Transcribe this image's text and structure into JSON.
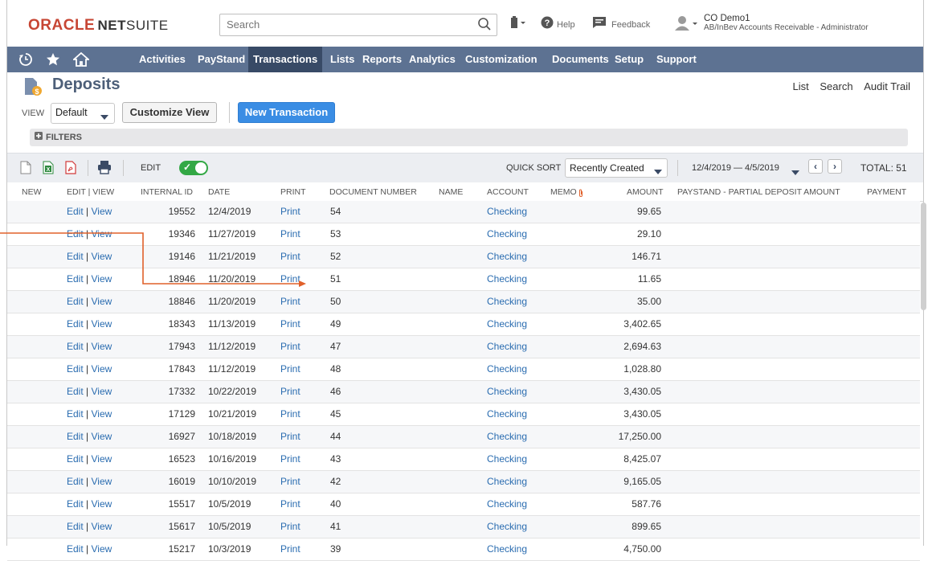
{
  "header": {
    "logo_oracle": "ORACLE",
    "logo_net": "NET",
    "logo_suite": "SUITE",
    "search_placeholder": "Search",
    "help_label": "Help",
    "feedback_label": "Feedback",
    "user_name": "CO Demo1",
    "user_role": "AB/InBev Accounts Receivable - Administrator"
  },
  "nav": {
    "items": [
      "Activities",
      "PayStand",
      "Transactions",
      "Lists",
      "Reports",
      "Analytics",
      "Customization",
      "Documents",
      "Setup",
      "Support"
    ],
    "active": "Transactions"
  },
  "page": {
    "title": "Deposits",
    "links": [
      "List",
      "Search",
      "Audit Trail"
    ],
    "view_label": "VIEW",
    "view_value": "Default",
    "customize_view": "Customize View",
    "new_transaction": "New Transaction",
    "filters_label": "FILTERS"
  },
  "toolbar": {
    "edit_label": "EDIT",
    "quick_sort_label": "QUICK SORT",
    "quick_sort_value": "Recently Created",
    "date_range": "12/4/2019 — 4/5/2019",
    "total": "TOTAL: 51"
  },
  "table": {
    "columns": [
      "NEW",
      "EDIT | VIEW",
      "INTERNAL ID",
      "DATE",
      "PRINT",
      "DOCUMENT NUMBER",
      "NAME",
      "ACCOUNT",
      "MEMO",
      "AMOUNT",
      "PAYSTAND - PARTIAL DEPOSIT AMOUNT",
      "PAYMENT"
    ],
    "edit_text": "Edit",
    "view_text": "View",
    "print_text": "Print",
    "rows": [
      {
        "id": "19552",
        "date": "12/4/2019",
        "doc": "54",
        "account": "Checking",
        "amount": "99.65"
      },
      {
        "id": "19346",
        "date": "11/27/2019",
        "doc": "53",
        "account": "Checking",
        "amount": "29.10"
      },
      {
        "id": "19146",
        "date": "11/21/2019",
        "doc": "52",
        "account": "Checking",
        "amount": "146.71"
      },
      {
        "id": "18946",
        "date": "11/20/2019",
        "doc": "51",
        "account": "Checking",
        "amount": "11.65"
      },
      {
        "id": "18846",
        "date": "11/20/2019",
        "doc": "50",
        "account": "Checking",
        "amount": "35.00"
      },
      {
        "id": "18343",
        "date": "11/13/2019",
        "doc": "49",
        "account": "Checking",
        "amount": "3,402.65"
      },
      {
        "id": "17943",
        "date": "11/12/2019",
        "doc": "47",
        "account": "Checking",
        "amount": "2,694.63"
      },
      {
        "id": "17843",
        "date": "11/12/2019",
        "doc": "48",
        "account": "Checking",
        "amount": "1,028.80"
      },
      {
        "id": "17332",
        "date": "10/22/2019",
        "doc": "46",
        "account": "Checking",
        "amount": "3,430.05"
      },
      {
        "id": "17129",
        "date": "10/21/2019",
        "doc": "45",
        "account": "Checking",
        "amount": "3,430.05"
      },
      {
        "id": "16927",
        "date": "10/18/2019",
        "doc": "44",
        "account": "Checking",
        "amount": "17,250.00"
      },
      {
        "id": "16523",
        "date": "10/16/2019",
        "doc": "43",
        "account": "Checking",
        "amount": "8,425.07"
      },
      {
        "id": "16019",
        "date": "10/10/2019",
        "doc": "42",
        "account": "Checking",
        "amount": "9,165.05"
      },
      {
        "id": "15517",
        "date": "10/5/2019",
        "doc": "40",
        "account": "Checking",
        "amount": "587.76"
      },
      {
        "id": "15617",
        "date": "10/5/2019",
        "doc": "41",
        "account": "Checking",
        "amount": "899.65"
      },
      {
        "id": "15217",
        "date": "10/3/2019",
        "doc": "39",
        "account": "Checking",
        "amount": "4,750.00"
      }
    ]
  },
  "colors": {
    "nav_bg": "#5d7292",
    "nav_active": "#384a66",
    "link": "#2a6cb0",
    "primary_button": "#3a8de4",
    "toggle_on": "#33a845",
    "annotation_arrow": "#e0602a"
  }
}
